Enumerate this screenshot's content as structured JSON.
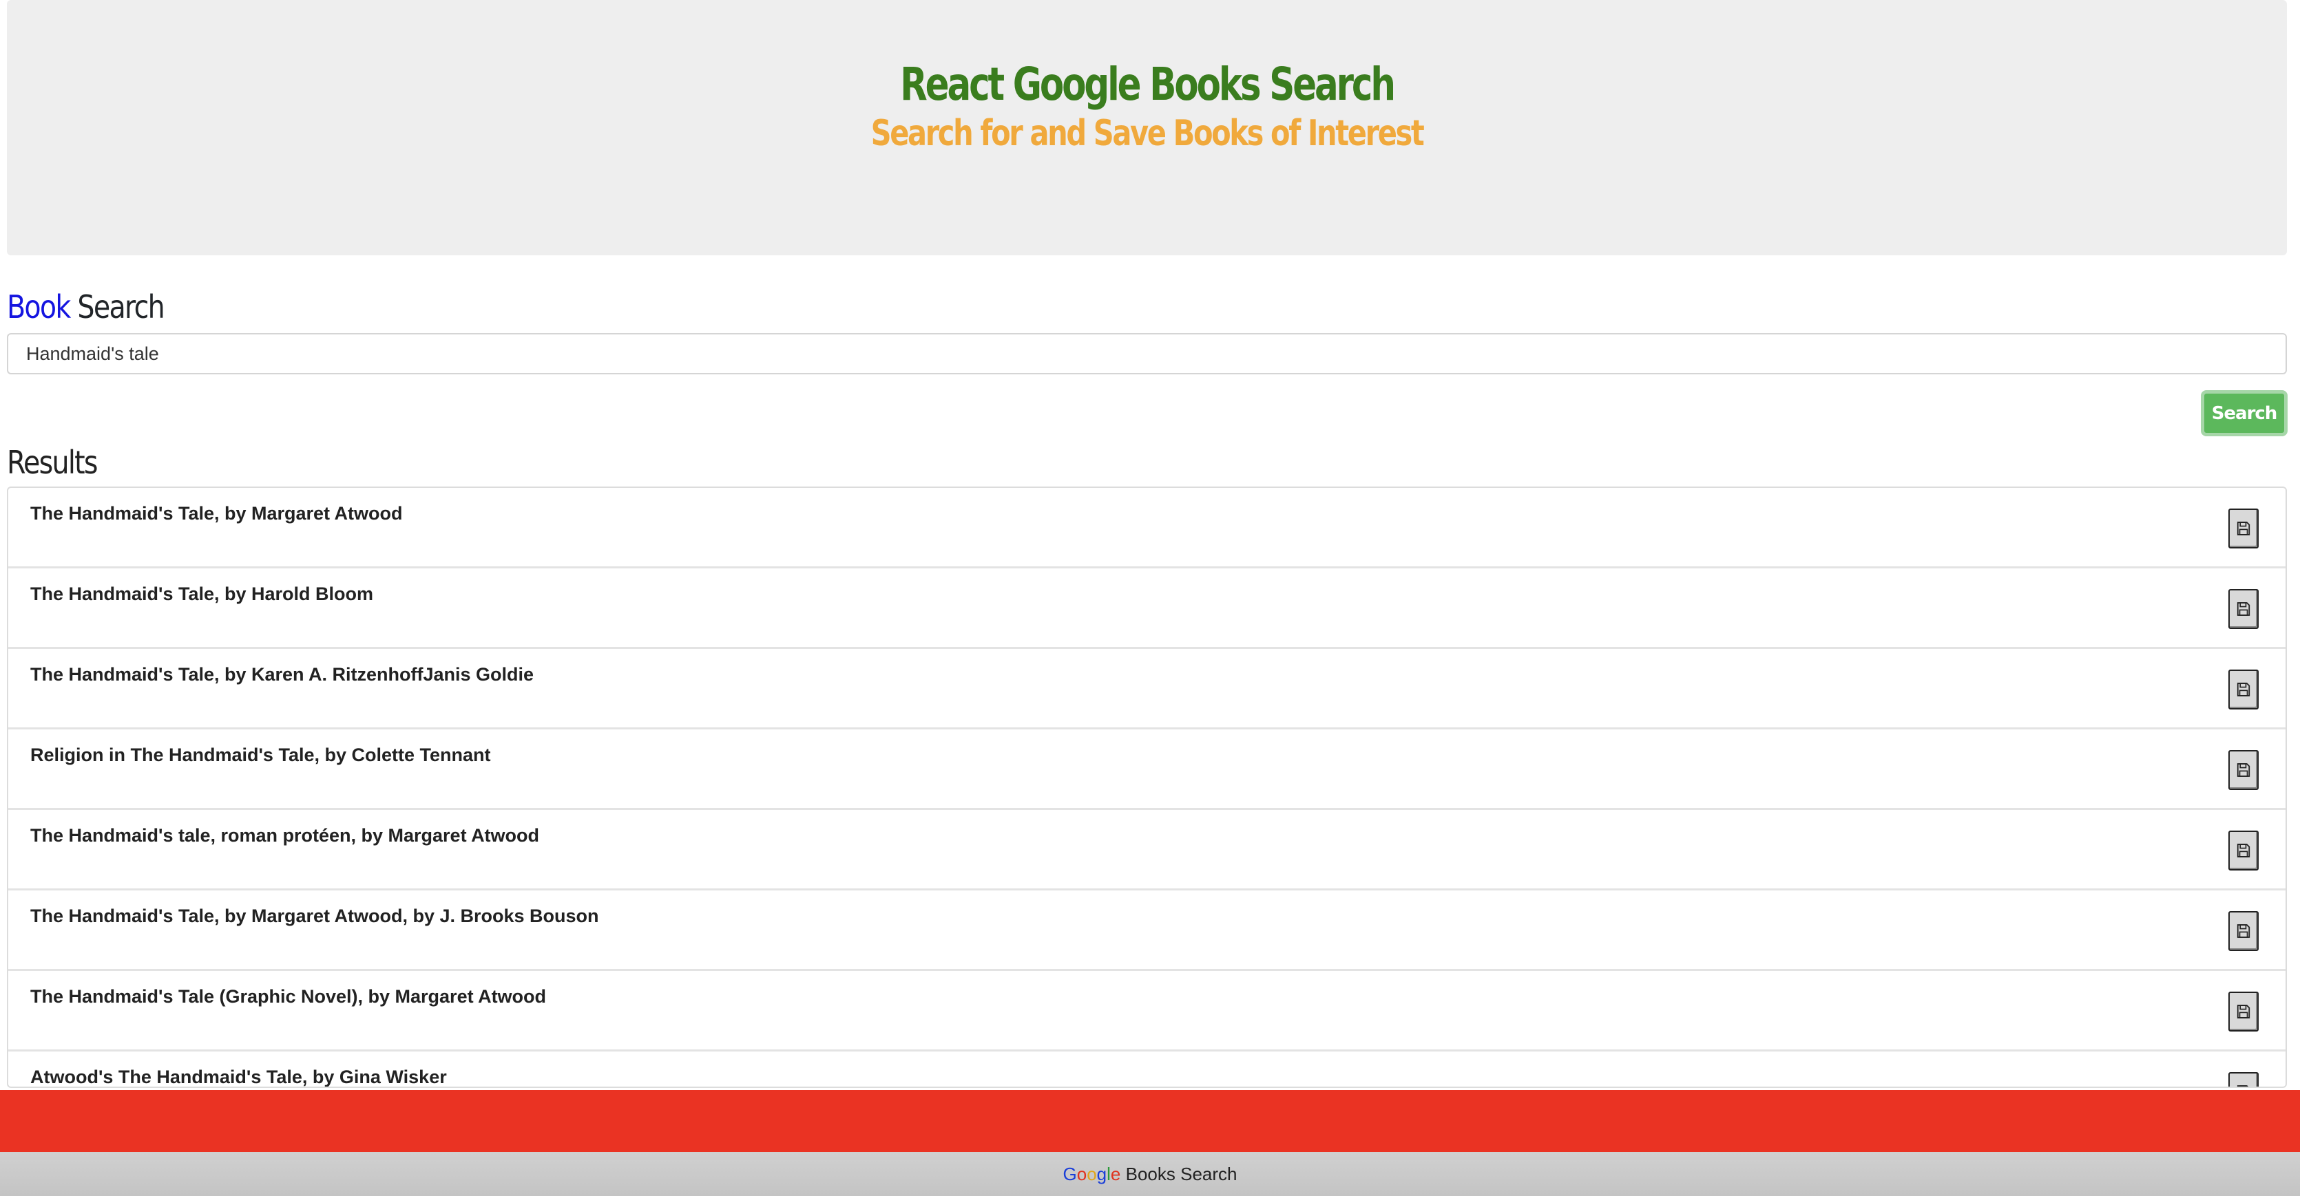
{
  "colors": {
    "title": "#3a7d1e",
    "subtitle": "#f0a93c",
    "book_word": "#1515e0",
    "search_button": "#5cb85c",
    "red_bar": "#ea3323",
    "footer_bg": "#c8c8c8"
  },
  "header": {
    "title": "React Google Books Search",
    "subtitle": "Search for and Save Books of Interest"
  },
  "search": {
    "heading_book": "Book",
    "heading_search": "Search",
    "input_value": "Handmaid's tale",
    "button_label": "Search"
  },
  "results": {
    "heading": "Results",
    "save_icon": "floppy-disk-icon",
    "items": [
      {
        "title": "The Handmaid's Tale, by Margaret Atwood"
      },
      {
        "title": "The Handmaid's Tale, by Harold Bloom"
      },
      {
        "title": "The Handmaid's Tale, by Karen A. RitzenhoffJanis Goldie"
      },
      {
        "title": "Religion in The Handmaid's Tale, by Colette Tennant"
      },
      {
        "title": "The Handmaid's tale, roman protéen, by Margaret Atwood"
      },
      {
        "title": "The Handmaid's Tale, by Margaret Atwood, by J. Brooks Bouson"
      },
      {
        "title": "The Handmaid's Tale (Graphic Novel), by Margaret Atwood"
      },
      {
        "title": "Atwood's The Handmaid's Tale, by Gina Wisker"
      }
    ]
  },
  "footer": {
    "google_letters": [
      "G",
      "o",
      "o",
      "g",
      "l",
      "e"
    ],
    "text": " Books Search"
  }
}
